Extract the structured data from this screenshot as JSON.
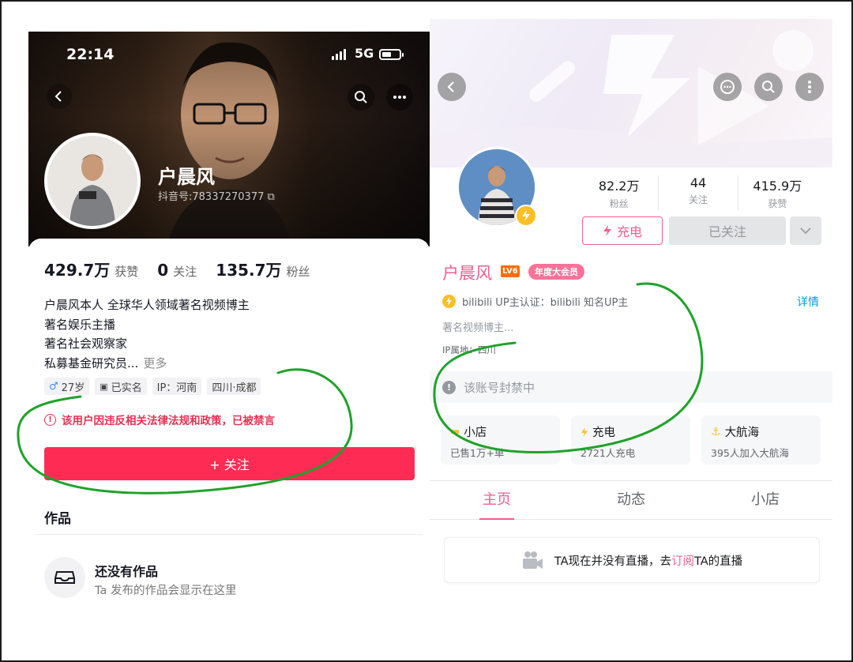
{
  "douyin": {
    "status_time": "22:14",
    "network": "5G",
    "profile_name": "户晨风",
    "douyin_id": "抖音号:78337270377",
    "stats": [
      {
        "value": "429.7万",
        "label": "获赞"
      },
      {
        "value": "0",
        "label": "关注"
      },
      {
        "value": "135.7万",
        "label": "粉丝"
      }
    ],
    "bio_lines": [
      "户晨风本人 全球华人领域著名视频博主",
      "著名娱乐主播",
      "著名社会观察家",
      "私募基金研究员..."
    ],
    "bio_more": "更多",
    "tags": {
      "age": "27岁",
      "verified": "已实名",
      "ip": "IP：河南",
      "location": "四川·成都"
    },
    "ban_notice": "该用户因违反相关法律法规和政策，已被禁言",
    "follow_button": "+ 关注",
    "works_title": "作品",
    "empty_title": "还没有作品",
    "empty_sub": "Ta 发布的作品会显示在这里"
  },
  "bilibili": {
    "stats": [
      {
        "value": "82.2万",
        "label": "粉丝"
      },
      {
        "value": "44",
        "label": "关注"
      },
      {
        "value": "415.9万",
        "label": "获赞"
      }
    ],
    "charge_button": "充电",
    "followed_button": "已关注",
    "name": "户晨风",
    "level": "LV6",
    "vip_badge": "年度大会员",
    "certification": "bilibili UP主认证：bilibili 知名UP主",
    "detail_link": "详情",
    "signature": "著名视频博主...",
    "ip_location": "IP属地：四川",
    "ban_notice": "该账号封禁中",
    "cards": [
      {
        "title": "小店",
        "sub": "已售1万+单"
      },
      {
        "title": "充电",
        "sub": "2721人充电"
      },
      {
        "title": "大航海",
        "sub": "395人加入大航海"
      }
    ],
    "tabs": [
      "主页",
      "动态",
      "小店"
    ],
    "live_prefix": "TA现在并没有直播，去",
    "live_link": "订阅",
    "live_suffix": "TA的直播"
  },
  "colors": {
    "douyin_red": "#fe2c55",
    "bili_pink": "#f25d8e",
    "annotation_green": "#1fa22a"
  }
}
